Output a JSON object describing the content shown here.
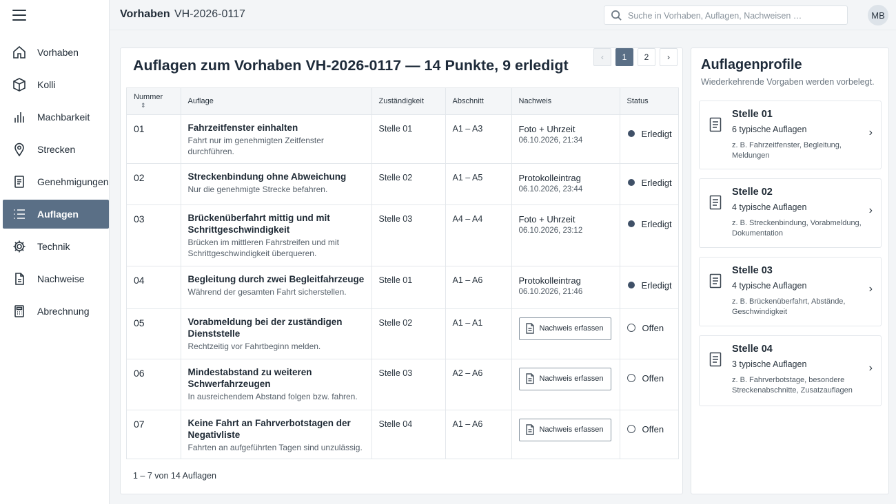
{
  "nav": {
    "items": [
      {
        "label": "Vorhaben",
        "icon": "home-icon"
      },
      {
        "label": "Kolli",
        "icon": "box-icon"
      },
      {
        "label": "Machbarkeit",
        "icon": "bar-chart-icon"
      },
      {
        "label": "Strecken",
        "icon": "map-pin-icon"
      },
      {
        "label": "Genehmigungen",
        "icon": "document-icon"
      },
      {
        "label": "Auflagen",
        "icon": "list-icon",
        "active": true
      },
      {
        "label": "Technik",
        "icon": "gear-icon"
      },
      {
        "label": "Nachweise",
        "icon": "file-icon"
      },
      {
        "label": "Abrechnung",
        "icon": "calculator-icon"
      }
    ]
  },
  "header": {
    "breadcrumb_root": "Vorhaben",
    "breadcrumb_current": "VH-2026-0117",
    "search_placeholder": "Suche in Vorhaben, Auflagen, Nachweisen …",
    "avatar_initials": "MB"
  },
  "main": {
    "title": "Auflagen zum Vorhaben VH-2026-0117 — 14 Punkte, 9 erledigt",
    "columns": {
      "nummer": "Nummer",
      "auflage": "Auflage",
      "zustaendigkeit": "Zuständigkeit",
      "abschnitt": "Abschnitt",
      "nachweis": "Nachweis",
      "status": "Status"
    },
    "rows": [
      {
        "nummer": "01",
        "title": "Fahrzeitfenster einhalten",
        "desc": "Fahrt nur im genehmigten Zeitfenster durchführen.",
        "stelle": "Stelle 01",
        "abschnitt": "A1 – A3",
        "nachweis_type": "Foto + Uhrzeit",
        "nachweis_time": "06.10.2026, 21:34",
        "status": "Erledigt"
      },
      {
        "nummer": "02",
        "title": "Streckenbindung ohne Abweichung",
        "desc": "Nur die genehmigte Strecke befahren.",
        "stelle": "Stelle 02",
        "abschnitt": "A1 – A5",
        "nachweis_type": "Protokolleintrag",
        "nachweis_time": "06.10.2026, 23:44",
        "status": "Erledigt"
      },
      {
        "nummer": "03",
        "title": "Brückenüberfahrt mittig und mit Schrittgeschwindigkeit",
        "desc": "Brücken im mittleren Fahrstreifen und mit Schrittgeschwindigkeit überqueren.",
        "stelle": "Stelle 03",
        "abschnitt": "A4 – A4",
        "nachweis_type": "Foto + Uhrzeit",
        "nachweis_time": "06.10.2026, 23:12",
        "status": "Erledigt"
      },
      {
        "nummer": "04",
        "title": "Begleitung durch zwei Begleitfahrzeuge",
        "desc": "Während der gesamten Fahrt sicherstellen.",
        "stelle": "Stelle 01",
        "abschnitt": "A1 – A6",
        "nachweis_type": "Protokolleintrag",
        "nachweis_time": "06.10.2026, 21:46",
        "status": "Erledigt"
      },
      {
        "nummer": "05",
        "title": "Vorabmeldung bei der zuständigen Dienststelle",
        "desc": "Rechtzeitig vor Fahrtbeginn melden.",
        "stelle": "Stelle 02",
        "abschnitt": "A1 – A1",
        "nachweis_button": "Nachweis erfassen",
        "status": "Offen"
      },
      {
        "nummer": "06",
        "title": "Mindestabstand zu weiteren Schwerfahrzeugen",
        "desc": "In ausreichendem Abstand folgen bzw. fahren.",
        "stelle": "Stelle 03",
        "abschnitt": "A2 – A6",
        "nachweis_button": "Nachweis erfassen",
        "status": "Offen"
      },
      {
        "nummer": "07",
        "title": "Keine Fahrt an Fahrverbotstagen der Negativliste",
        "desc": "Fahrten an aufgeführten Tagen sind unzulässig.",
        "stelle": "Stelle 04",
        "abschnitt": "A1 – A6",
        "nachweis_button": "Nachweis erfassen",
        "status": "Offen"
      }
    ],
    "footer_count": "1 – 7 von 14 Auflagen",
    "pagination": {
      "pages": [
        "1",
        "2"
      ],
      "current": "1",
      "prev": "‹",
      "next": "›"
    }
  },
  "profiles": {
    "title": "Auflagenprofile",
    "subtitle": "Wiederkehrende Vorgaben werden vorbelegt.",
    "items": [
      {
        "name": "Stelle 01",
        "count": "6 typische Auflagen",
        "examples": "z. B. Fahrzeitfenster, Begleitung, Meldungen"
      },
      {
        "name": "Stelle 02",
        "count": "4 typische Auflagen",
        "examples": "z. B. Streckenbindung, Vorabmeldung, Dokumentation"
      },
      {
        "name": "Stelle 03",
        "count": "4 typische Auflagen",
        "examples": "z. B. Brückenüberfahrt, Abstände, Geschwindigkeit"
      },
      {
        "name": "Stelle 04",
        "count": "3 typische Auflagen",
        "examples": "z. B. Fahrverbotstage, besondere Streckenabschnitte, Zusatzauflagen"
      }
    ]
  },
  "colors": {
    "accent": "#5a6f86",
    "done_dot": "#3f5067",
    "page_bg": "#f3f5f7"
  }
}
